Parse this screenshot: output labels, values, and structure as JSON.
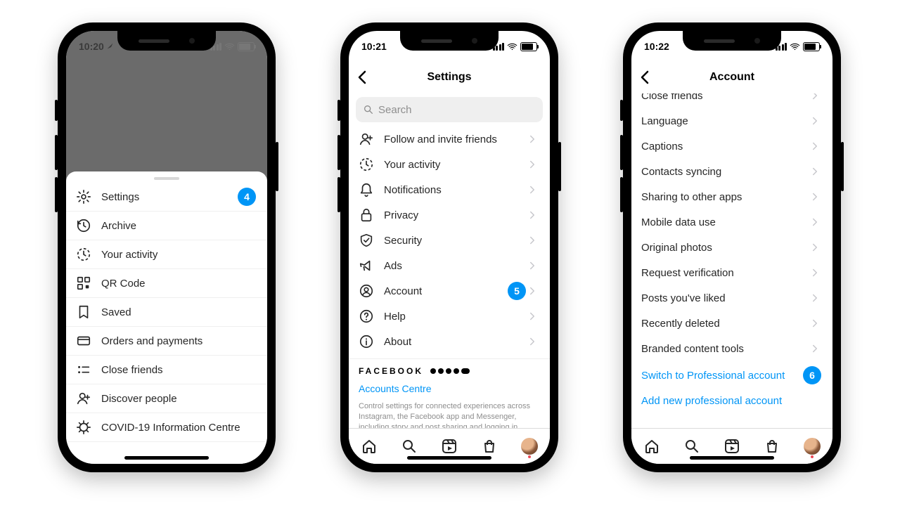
{
  "phone1": {
    "status_time": "10:20",
    "sheet": {
      "items": [
        {
          "icon": "gear",
          "label": "Settings",
          "badge": "4"
        },
        {
          "icon": "archive",
          "label": "Archive"
        },
        {
          "icon": "activity",
          "label": "Your activity"
        },
        {
          "icon": "qr",
          "label": "QR Code"
        },
        {
          "icon": "bookmark",
          "label": "Saved"
        },
        {
          "icon": "card",
          "label": "Orders and payments"
        },
        {
          "icon": "closefriends",
          "label": "Close friends"
        },
        {
          "icon": "discover",
          "label": "Discover people"
        },
        {
          "icon": "covid",
          "label": "COVID-19 Information Centre"
        }
      ]
    }
  },
  "phone2": {
    "status_time": "10:21",
    "title": "Settings",
    "search_placeholder": "Search",
    "items": [
      {
        "icon": "discover",
        "label": "Follow and invite friends"
      },
      {
        "icon": "activity",
        "label": "Your activity"
      },
      {
        "icon": "bell",
        "label": "Notifications"
      },
      {
        "icon": "lock",
        "label": "Privacy"
      },
      {
        "icon": "shield",
        "label": "Security"
      },
      {
        "icon": "ads",
        "label": "Ads"
      },
      {
        "icon": "account",
        "label": "Account",
        "badge": "5"
      },
      {
        "icon": "help",
        "label": "Help"
      },
      {
        "icon": "about",
        "label": "About"
      }
    ],
    "fb_heading": "FACEBOOK",
    "fb_link": "Accounts Centre",
    "fb_note": "Control settings for connected experiences across Instagram, the Facebook app and Messenger, including story and post sharing and logging in."
  },
  "phone3": {
    "status_time": "10:22",
    "title": "Account",
    "items": [
      {
        "label": "Close friends"
      },
      {
        "label": "Language"
      },
      {
        "label": "Captions"
      },
      {
        "label": "Contacts syncing"
      },
      {
        "label": "Sharing to other apps"
      },
      {
        "label": "Mobile data use"
      },
      {
        "label": "Original photos"
      },
      {
        "label": "Request verification"
      },
      {
        "label": "Posts you've liked"
      },
      {
        "label": "Recently deleted"
      },
      {
        "label": "Branded content tools"
      }
    ],
    "links": [
      {
        "label": "Switch to Professional account",
        "badge": "6"
      },
      {
        "label": "Add new professional account"
      }
    ]
  }
}
